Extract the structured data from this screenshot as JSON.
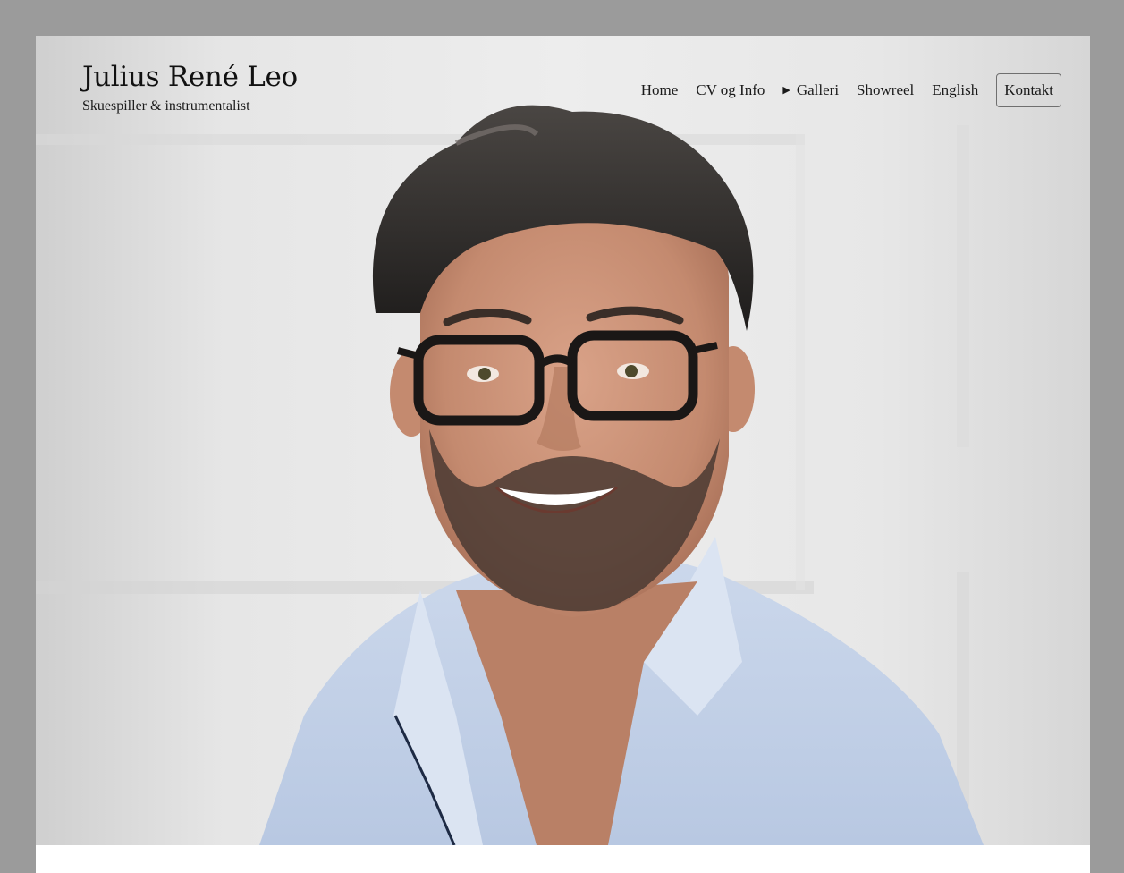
{
  "site": {
    "title": "Julius René Leo",
    "tagline": "Skuespiller & instrumentalist"
  },
  "nav": {
    "items": [
      {
        "label": "Home"
      },
      {
        "label": "CV og Info"
      },
      {
        "label": "Galleri",
        "has_submenu": true
      },
      {
        "label": "Showreel"
      },
      {
        "label": "English"
      }
    ],
    "contact_label": "Kontakt",
    "submenu_icon": "triangle-right-icon"
  },
  "hero": {
    "image": "portrait-photo"
  },
  "colors": {
    "page_background": "#9b9b9b",
    "text": "#1a1a1a",
    "shirt": "#c9d6ea"
  }
}
